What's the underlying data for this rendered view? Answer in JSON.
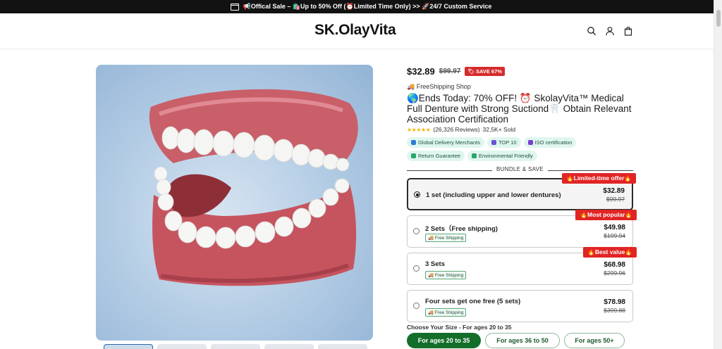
{
  "announcement": {
    "text": "📢Offical Sale – 🛍️Up to 50% Off (⏰Limited Time Only) >> 🚀24/7 Custom Service"
  },
  "header": {
    "logo": "SK.OlayVita",
    "icons": [
      "search-icon",
      "account-icon",
      "cart-icon"
    ]
  },
  "product": {
    "price": "$32.89",
    "compare_price": "$99.97",
    "save_badge": "SAVE 67%",
    "shop": "🚚 FreeShipping Shop",
    "title": "🌎Ends Today: 70% OFF! ⏰ SkolayVita™ Medical Full Denture with Strong Suctiond🦷 Obtain Relevant Association Certification",
    "stars": "★★★★★",
    "reviews": "(26,326 Reviews)",
    "sold": "32,5K+ Sold",
    "tags": [
      {
        "label": "Global Delivery Merchants",
        "color": "#2f7bd6"
      },
      {
        "label": "TOP 10",
        "color": "#6a4fd8"
      },
      {
        "label": "ISO certification",
        "color": "#7a3fd1"
      },
      {
        "label": "Return Guarantee",
        "color": "#2aa56b"
      },
      {
        "label": "Environmental Friendly",
        "color": "#2aa56b"
      }
    ]
  },
  "bundle": {
    "heading": "BUNDLE & SAVE",
    "options": [
      {
        "label": "1 set (including upper and lower dentures)",
        "price": "$32.89",
        "compare": "$99.97",
        "ribbon": "🔥Limited-time offer🔥",
        "shipping": "",
        "selected": true
      },
      {
        "label": "2 Sets（Free shipping)",
        "price": "$49.98",
        "compare": "$199.94",
        "ribbon": "🔥Most popular🔥",
        "shipping": "🚚 Free Shipping",
        "selected": false
      },
      {
        "label": "3 Sets",
        "price": "$68.98",
        "compare": "$299.96",
        "ribbon": "🔥Best value🔥",
        "shipping": "🚚 Free Shipping",
        "selected": false
      },
      {
        "label": "Four sets get one free (5 sets)",
        "price": "$78.98",
        "compare": "$399.88",
        "ribbon": "",
        "shipping": "🚚 Free Shipping",
        "selected": false
      }
    ]
  },
  "size": {
    "label": "Choose Your Size - For ages 20 to 35",
    "options": [
      "For ages 20 to 35",
      "For ages 36 to 50",
      "For ages 50+"
    ],
    "selected_index": 0
  },
  "colors": {
    "accent_red": "#e02424",
    "accent_green": "#136e2a",
    "tag_bg": "#dff6ee"
  }
}
